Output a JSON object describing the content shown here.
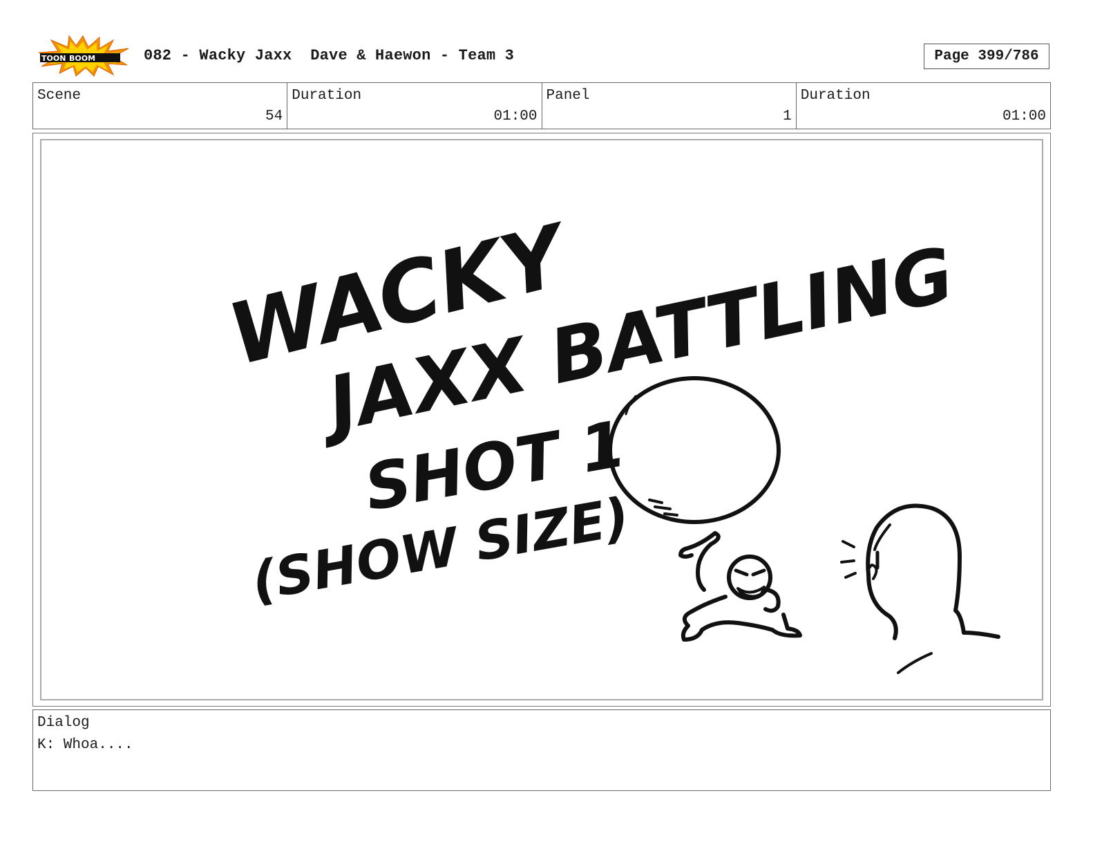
{
  "header": {
    "logo": {
      "brand_top": "TOON",
      "brand_bottom": "BOOM",
      "name": "toon-boom-logo"
    },
    "title": "082 - Wacky Jaxx  Dave & Haewon - Team 3",
    "page": "Page 399/786"
  },
  "info": [
    {
      "label": "Scene",
      "value": "54"
    },
    {
      "label": "Duration",
      "value": "01:00"
    },
    {
      "label": "Panel",
      "value": "1"
    },
    {
      "label": "Duration",
      "value": "01:00"
    }
  ],
  "panel": {
    "sketch_text": {
      "line1": "WACKY",
      "line2": "JAXX BATTLING",
      "line3": "SHOT 1",
      "line4": "(SHOW SIZE)"
    }
  },
  "dialog": {
    "label": "Dialog",
    "text": "K: Whoa...."
  },
  "colors": {
    "logo_orange": "#f39200",
    "logo_yellow": "#ffd200",
    "ink": "#111111"
  }
}
